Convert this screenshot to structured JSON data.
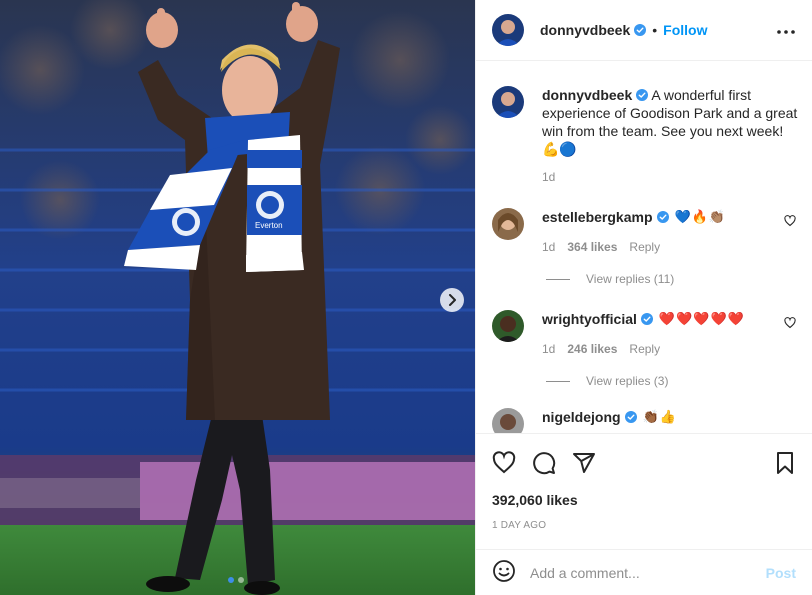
{
  "post": {
    "author": "donnyvdbeek",
    "follow_label": "Follow",
    "separator": "•",
    "more_icon": "more-horizontal-icon",
    "caption": "A wonderful first experience of Goodison Park and a great win from the team. See you next week!",
    "caption_emojis": "💪🔵",
    "caption_time": "1d",
    "scarf_text": "Everton",
    "media_count": 2,
    "media_active_index": 0
  },
  "comments": [
    {
      "username": "estellebergkamp",
      "emojis": "💙🔥👏🏽",
      "time": "1d",
      "likes": "364 likes",
      "reply_label": "Reply",
      "view_replies": "View replies (11)"
    },
    {
      "username": "wrightyofficial",
      "emojis": "❤️❤️❤️❤️❤️",
      "time": "1d",
      "likes": "246 likes",
      "reply_label": "Reply",
      "view_replies": "View replies (3)"
    },
    {
      "username": "nigeldejong",
      "emojis": "👏🏾👍"
    }
  ],
  "actions": {
    "like_icon": "heart-icon",
    "comment_icon": "comment-icon",
    "share_icon": "share-icon",
    "save_icon": "bookmark-icon",
    "likes": "392,060 likes",
    "time_ago": "1 DAY AGO"
  },
  "add_comment": {
    "placeholder": "Add a comment...",
    "post_label": "Post",
    "emoji_icon": "emoji-icon"
  },
  "colors": {
    "accent": "#0095f6",
    "verified": "#3897f0",
    "everton_blue": "#1b4fb8",
    "post_disabled": "#b2dffc"
  }
}
